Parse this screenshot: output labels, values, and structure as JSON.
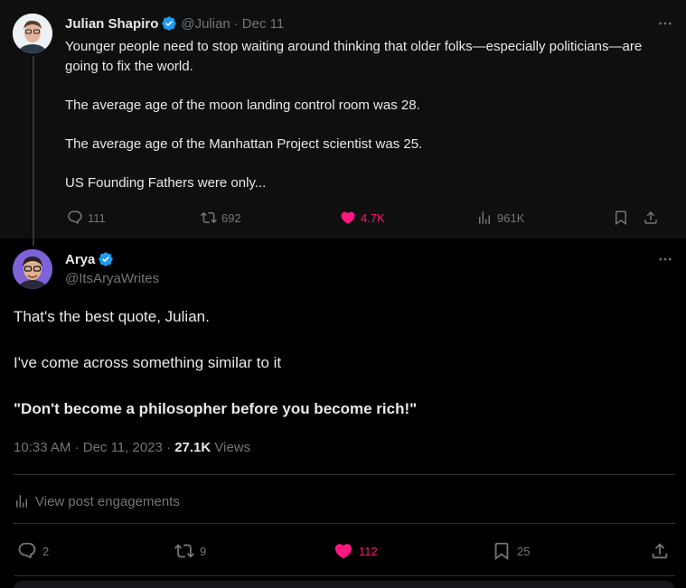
{
  "parent_tweet": {
    "author_name": "Julian Shapiro",
    "handle": "@Julian",
    "separator": "·",
    "date": "Dec 11",
    "lines": [
      "Younger people need to stop waiting around thinking that older folks—especially politicians—are going to fix the world.",
      "The average age of the moon landing control room was 28.",
      "The average age of the Manhattan Project scientist was 25.",
      "US Founding Fathers were only..."
    ],
    "replies": "111",
    "reposts": "692",
    "likes": "4.7K",
    "views": "961K"
  },
  "reply_tweet": {
    "author_name": "Arya",
    "handle": "@ItsAryaWrites",
    "line1": "That's the best quote, Julian.",
    "line2": "I've come across something similar to it",
    "line3": "\"Don't become a philosopher before you become rich!\"",
    "time": "10:33 AM",
    "separator": "·",
    "date": "Dec 11, 2023",
    "views_count": "27.1K",
    "views_label": "Views",
    "engagements_label": "View post engagements",
    "replies": "2",
    "reposts": "9",
    "likes": "112",
    "bookmarks": "25"
  },
  "colors": {
    "like_pink": "#f91880",
    "verified_blue": "#1d9bf0",
    "muted": "#71767b"
  },
  "icons": [
    "verified-badge-icon",
    "more-icon",
    "reply-icon",
    "repost-icon",
    "like-icon",
    "views-icon",
    "bookmark-icon",
    "share-icon",
    "analytics-icon"
  ]
}
